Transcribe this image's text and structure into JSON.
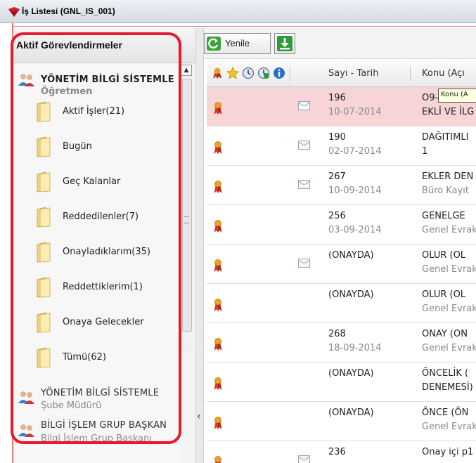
{
  "window": {
    "title": "İş Listesi (GNL_IS_001)"
  },
  "left_panel": {
    "header": "Aktif Görevlendirmeler",
    "users": [
      {
        "name": "YÖNETİM BİLGİ SİSTEMLE",
        "role": "Öğretmen"
      },
      {
        "name": "YÖNETİM BİLGİ SİSTEMLE",
        "role": "Şube Müdürü"
      },
      {
        "name": "BİLGİ İŞLEM GRUP BAŞKAN",
        "role": "Bilgi İşlem Grup Başkanı"
      }
    ],
    "folders": [
      {
        "label": "Aktif İşler(21)"
      },
      {
        "label": "Bugün"
      },
      {
        "label": "Geç Kalanlar"
      },
      {
        "label": "Reddedilenler(7)"
      },
      {
        "label": "Onayladıklarım(35)"
      },
      {
        "label": "Reddettiklerim(1)"
      },
      {
        "label": "Onaya Gelecekler"
      },
      {
        "label": "Tümü(62)"
      }
    ]
  },
  "toolbar": {
    "refresh_label": "Yenile",
    "export_icon": "download-icon"
  },
  "grid": {
    "columns": {
      "sayi_tarih": "Sayı - Tarih",
      "konu": "Konu (Açı"
    },
    "header_icons": [
      "ribbon-icon",
      "star-icon",
      "clock-icon",
      "clock-arrow-icon",
      "info-icon"
    ],
    "tooltip": "Konu (A",
    "rows": [
      {
        "sayi": "196",
        "tarih": "10-07-2014",
        "konu1": "O9-",
        "konu2": "EKLİ VE İLG",
        "mail": true,
        "selected": true,
        "konu2_dark": true
      },
      {
        "sayi": "190",
        "tarih": "02-07-2014",
        "konu1": "DAĞITIMLI",
        "konu2": "1",
        "mail": true,
        "selected": false,
        "konu2_dark": true
      },
      {
        "sayi": "267",
        "tarih": "10-09-2014",
        "konu1": "EKLER DEN",
        "konu2": "Büro Kayıt",
        "mail": true,
        "selected": false
      },
      {
        "sayi": "256",
        "tarih": "03-09-2014",
        "konu1": "GENELGE",
        "konu2": "Genel Evrak",
        "mail": false,
        "selected": false
      },
      {
        "sayi": "(ONAYDA)",
        "tarih": "",
        "konu1": "OLUR  (OL",
        "konu2": "Genel Evrak",
        "mail": true,
        "selected": false
      },
      {
        "sayi": "(ONAYDA)",
        "tarih": "",
        "konu1": "OLUR  (OL",
        "konu2": "Genel Evrak",
        "mail": false,
        "selected": false
      },
      {
        "sayi": "268",
        "tarih": "18-09-2014",
        "konu1": "ONAY  (ON",
        "konu2": "Genel Evrak",
        "mail": false,
        "selected": false
      },
      {
        "sayi": "(ONAYDA)",
        "tarih": "",
        "konu1": "ÖNCELİK  (",
        "konu2": "DENEMESİ)",
        "mail": false,
        "selected": false,
        "konu2_dark": true
      },
      {
        "sayi": "(ONAYDA)",
        "tarih": "",
        "konu1": "ÖNCE  (ÖN",
        "konu2": "Genel Evrak",
        "mail": false,
        "selected": false
      },
      {
        "sayi": "236",
        "tarih": "",
        "konu1": "Onay içi p1",
        "konu2": "",
        "mail": true,
        "selected": false
      }
    ]
  },
  "colors": {
    "annotation": "#e8192c",
    "selected_row": "#f7d5d7",
    "ribbon": "#d83a1f"
  }
}
